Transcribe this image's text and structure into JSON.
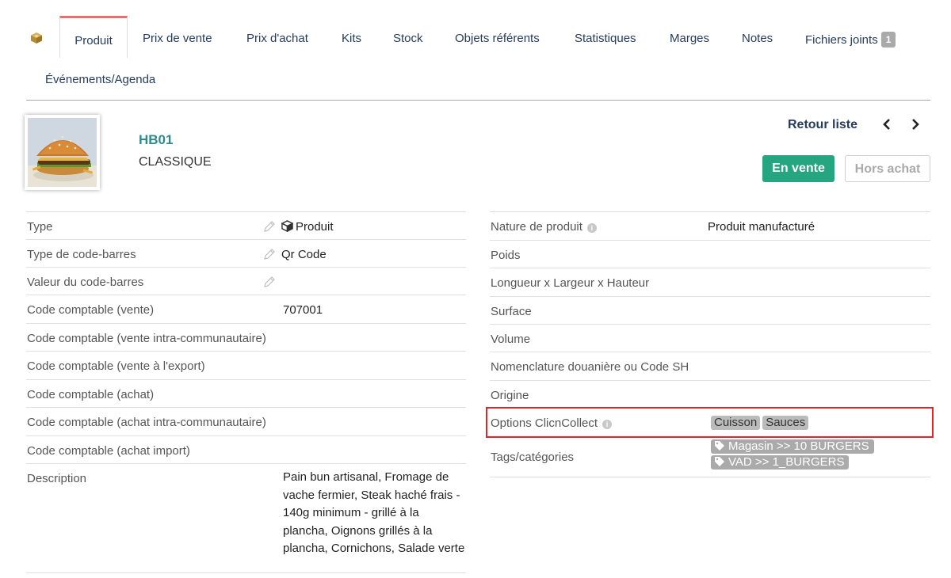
{
  "tabs": {
    "items": [
      {
        "label": "Produit",
        "active": true
      },
      {
        "label": "Prix de vente"
      },
      {
        "label": "Prix d'achat"
      },
      {
        "label": "Kits"
      },
      {
        "label": "Stock"
      },
      {
        "label": "Objets référents"
      },
      {
        "label": "Statistiques"
      },
      {
        "label": "Marges"
      },
      {
        "label": "Notes"
      },
      {
        "label": "Fichiers joints",
        "badge": "1"
      },
      {
        "label": "Événements/Agenda"
      }
    ]
  },
  "product": {
    "ref": "HB01",
    "name": "CLASSIQUE"
  },
  "nav": {
    "back_label": "Retour liste",
    "prev": "<",
    "next": ">"
  },
  "status": {
    "sell": "En vente",
    "buy": "Hors achat"
  },
  "left_fields": [
    {
      "key": "Type",
      "value": "Produit"
    },
    {
      "key": "Type de code-barres",
      "value": "Qr Code"
    },
    {
      "key": "Valeur du code-barres",
      "value": ""
    },
    {
      "key": "Code comptable (vente)",
      "value": "707001"
    },
    {
      "key": "Code comptable (vente intra-communautaire)",
      "value": ""
    },
    {
      "key": "Code comptable (vente à l'export)",
      "value": ""
    },
    {
      "key": "Code comptable (achat)",
      "value": ""
    },
    {
      "key": "Code comptable (achat intra-communautaire)",
      "value": ""
    },
    {
      "key": "Code comptable (achat import)",
      "value": ""
    },
    {
      "key": "Description",
      "value": "Pain bun artisanal, Fromage de vache fermier, Steak haché frais - 140g minimum - grillé à la plancha, Oignons grillés à la plancha, Cornichons, Salade verte"
    }
  ],
  "right_fields": [
    {
      "key": "Nature de produit",
      "value": "Produit manufacturé"
    },
    {
      "key": "Poids",
      "value": ""
    },
    {
      "key": "Longueur x Largeur x Hauteur",
      "value": ""
    },
    {
      "key": "Surface",
      "value": ""
    },
    {
      "key": "Volume",
      "value": ""
    },
    {
      "key": "Nomenclature douanière ou Code SH",
      "value": ""
    },
    {
      "key": "Origine",
      "value": ""
    },
    {
      "key": "Options ClicnCollect",
      "chips": [
        "Cuisson",
        "Sauces"
      ]
    },
    {
      "key": "Tags/catégories",
      "tags": [
        "Magasin >> 10 BURGERS",
        "VAD >> 1_BURGERS"
      ]
    }
  ],
  "colors": {
    "accent_tab": "#e57171",
    "link": "#263c5c",
    "ref": "#2e8b8b",
    "status_green": "#25a580",
    "highlight": "#e0262b"
  },
  "icons": {
    "module": "cube-icon",
    "edit": "pencil-icon",
    "info": "info-icon",
    "tag": "tag-icon"
  }
}
